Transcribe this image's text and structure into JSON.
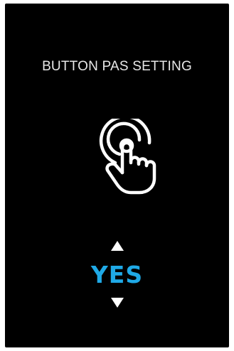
{
  "screen": {
    "title": "BUTTON PAS SETTING",
    "icon": "touch-hand-icon",
    "value": "YES",
    "colors": {
      "background": "#000000",
      "title": "#e8e8e8",
      "value": "#1fa9e6",
      "icon": "#ffffff"
    },
    "controls": {
      "up": "triangle-up-icon",
      "down": "triangle-down-icon"
    }
  }
}
